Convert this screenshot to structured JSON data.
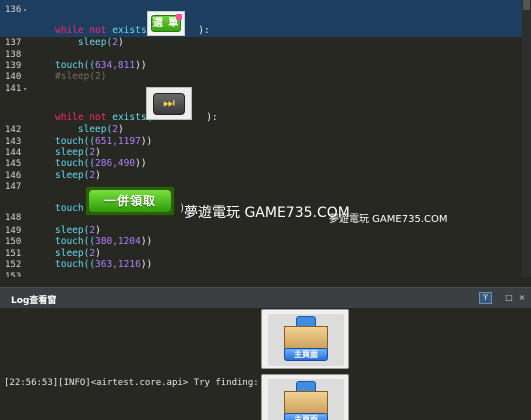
{
  "editor": {
    "lines": [
      {
        "num": "136",
        "fold": "▾"
      },
      {
        "num": "137",
        "fold": ""
      },
      {
        "num": "138",
        "fold": ""
      },
      {
        "num": "139",
        "fold": ""
      },
      {
        "num": "140",
        "fold": ""
      },
      {
        "num": "141",
        "fold": "▾"
      },
      {
        "num": "142",
        "fold": ""
      },
      {
        "num": "143",
        "fold": ""
      },
      {
        "num": "144",
        "fold": ""
      },
      {
        "num": "145",
        "fold": ""
      },
      {
        "num": "146",
        "fold": ""
      },
      {
        "num": "147",
        "fold": ""
      },
      {
        "num": "148",
        "fold": ""
      },
      {
        "num": "149",
        "fold": ""
      },
      {
        "num": "150",
        "fold": ""
      },
      {
        "num": "151",
        "fold": ""
      },
      {
        "num": "152",
        "fold": ""
      },
      {
        "num": "153",
        "fold": ""
      }
    ],
    "code": {
      "l136_kw": "while not",
      "l136_fn": "exists(",
      "l136_end": "):",
      "l137_fn": "sleep(",
      "l137_num": "2",
      "l137_end": ")",
      "l139_fn": "touch((",
      "l139_num": "634,811",
      "l139_end": "))",
      "l140_cm": "#sleep(2)",
      "l141_kw": "while not",
      "l141_fn": "exists(",
      "l141_end": "):",
      "l142_fn": "sleep(",
      "l142_num": "2",
      "l142_end": ")",
      "l143_fn": "touch((",
      "l143_num": "651,1197",
      "l143_end": "))",
      "l144_fn": "sleep(",
      "l144_num": "2",
      "l144_end": ")",
      "l145_fn": "touch((",
      "l145_num": "286,490",
      "l145_end": "))",
      "l146_fn": "sleep(",
      "l146_num": "2",
      "l146_end": ")",
      "l148_fn": "touch(",
      "l148_end": ")",
      "l149_fn": "sleep(",
      "l149_num": "2",
      "l149_end": ")",
      "l150_fn": "touch((",
      "l150_num": "380,1204",
      "l150_end": "))",
      "l151_fn": "sleep(",
      "l151_num": "2",
      "l151_end": ")",
      "l152_fn": "touch((",
      "l152_num": "363,1216",
      "l152_end": "))"
    },
    "images": {
      "choose_label": "選 單",
      "fastforward_symbol": "⏭",
      "claim_label": "一併領取"
    },
    "watermark_big": "夢遊電玩 GAME735.COM",
    "watermark_small": "夢遊電玩 GAME735.COM"
  },
  "log_panel": {
    "title": "Log查看窗",
    "filter_symbol": "Y",
    "restore_symbol": "□",
    "close_symbol": "×",
    "log_line": "[22:56:53][INFO]<airtest.core.api> Try finding:",
    "thumb_label": "主頁面"
  },
  "colors": {
    "editor_bg": "#272822",
    "keyword": "#f92672",
    "function": "#66d9ef",
    "number": "#ae81ff",
    "comment": "#75715e",
    "selection": "#1d3e5e"
  }
}
